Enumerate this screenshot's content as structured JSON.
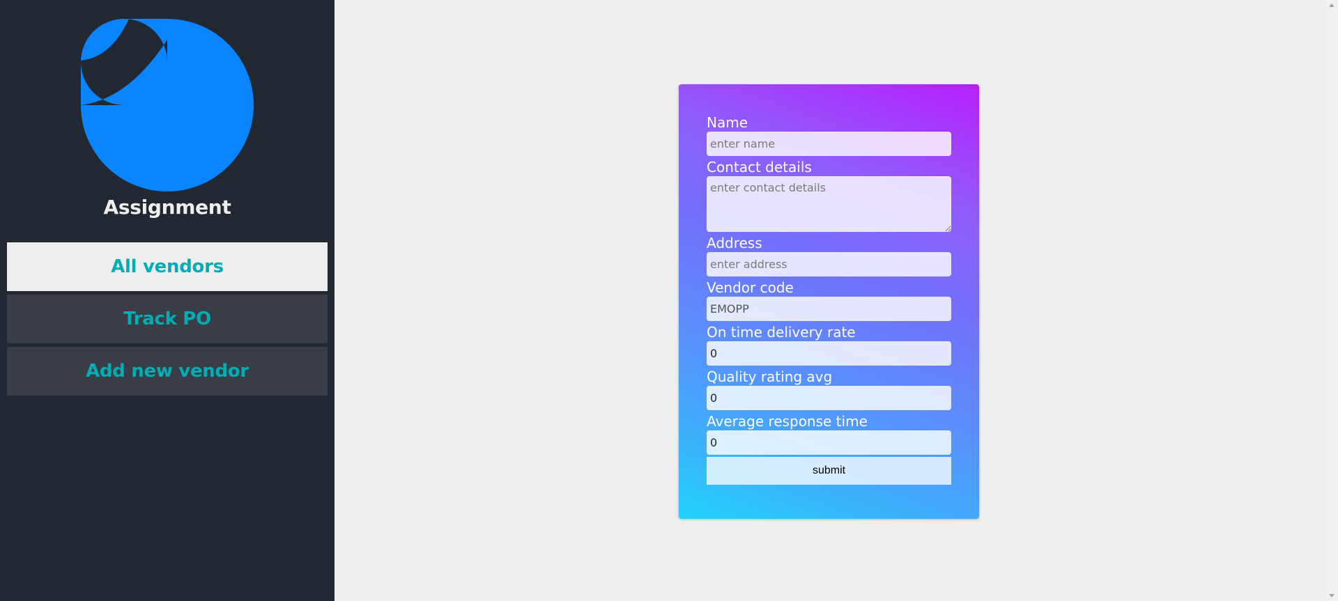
{
  "app": {
    "title": "Assignment",
    "logo_icon": "blue-swirl-logo-icon",
    "accent_color": "#0a84ff"
  },
  "sidebar": {
    "items": [
      {
        "label": "All vendors",
        "active": true
      },
      {
        "label": "Track PO",
        "active": false
      },
      {
        "label": "Add new vendor",
        "active": false
      }
    ]
  },
  "form": {
    "name": {
      "label": "Name",
      "placeholder": "enter name",
      "value": ""
    },
    "contact": {
      "label": "Contact details",
      "placeholder": "enter contact details",
      "value": ""
    },
    "address": {
      "label": "Address",
      "placeholder": "enter address",
      "value": ""
    },
    "vendor_code": {
      "label": "Vendor code",
      "value": "EMOPP"
    },
    "on_time_delivery": {
      "label": "On time delivery rate",
      "value": "0"
    },
    "quality_rating": {
      "label": "Quality rating avg",
      "value": "0"
    },
    "avg_response": {
      "label": "Average response time",
      "value": "0"
    },
    "submit_label": "submit"
  }
}
